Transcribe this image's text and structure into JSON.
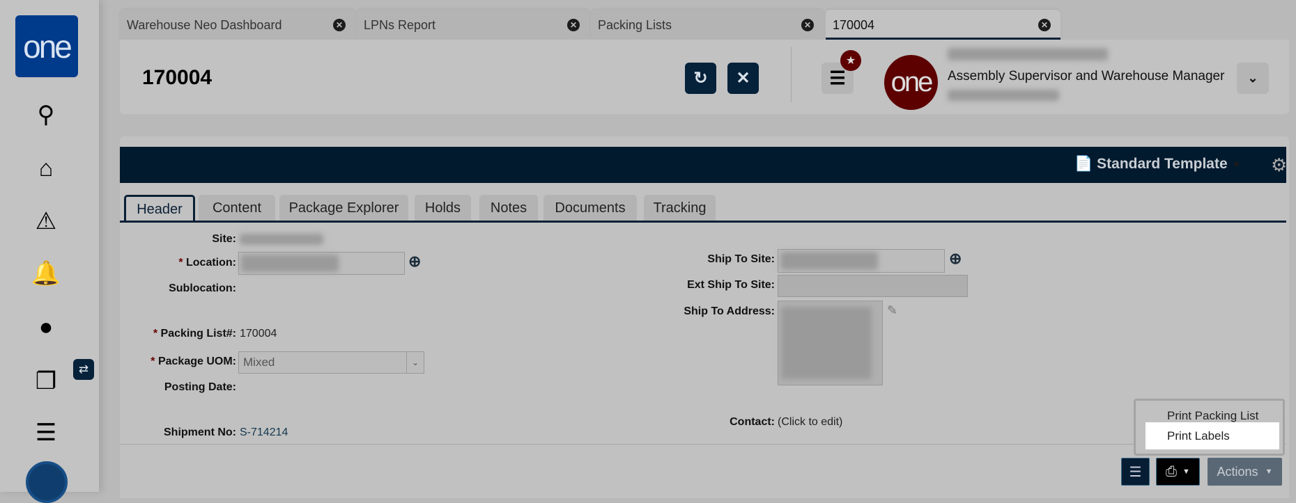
{
  "sidebar": {
    "logo": "one",
    "items": [
      "search",
      "home",
      "alerts",
      "notifications",
      "messages",
      "windows",
      "menu"
    ]
  },
  "tabs": [
    {
      "label": "Warehouse Neo Dashboard"
    },
    {
      "label": "LPNs Report"
    },
    {
      "label": "Packing Lists"
    },
    {
      "label": "170004",
      "active": true
    }
  ],
  "header": {
    "title": "170004",
    "user_logo": "one",
    "user_role": "Assembly Supervisor and Warehouse Manager"
  },
  "toolbar": {
    "template": "Standard Template"
  },
  "form_tabs": [
    "Header",
    "Content",
    "Package Explorer",
    "Holds",
    "Notes",
    "Documents",
    "Tracking"
  ],
  "form": {
    "site_label": "Site:",
    "location_label": "Location:",
    "sublocation_label": "Sublocation:",
    "packing_list_label": "Packing List#:",
    "packing_list_value": "170004",
    "package_uom_label": "Package UOM:",
    "package_uom_value": "Mixed",
    "posting_date_label": "Posting Date:",
    "shipment_no_label": "Shipment No:",
    "shipment_no_value": "S-714214",
    "ship_to_site_label": "Ship To Site:",
    "ext_ship_to_site_label": "Ext Ship To Site:",
    "ship_to_address_label": "Ship To Address:",
    "contact_label": "Contact:",
    "contact_value": "(Click to edit)",
    "required_mark": "*"
  },
  "print_menu": {
    "items": [
      "Print Packing List",
      "Print Labels"
    ],
    "highlighted": "Print Labels"
  },
  "footer": {
    "actions_label": "Actions"
  },
  "colors": {
    "bar": "#021a2e",
    "brand": "#003a8a",
    "user": "#5c0000"
  }
}
